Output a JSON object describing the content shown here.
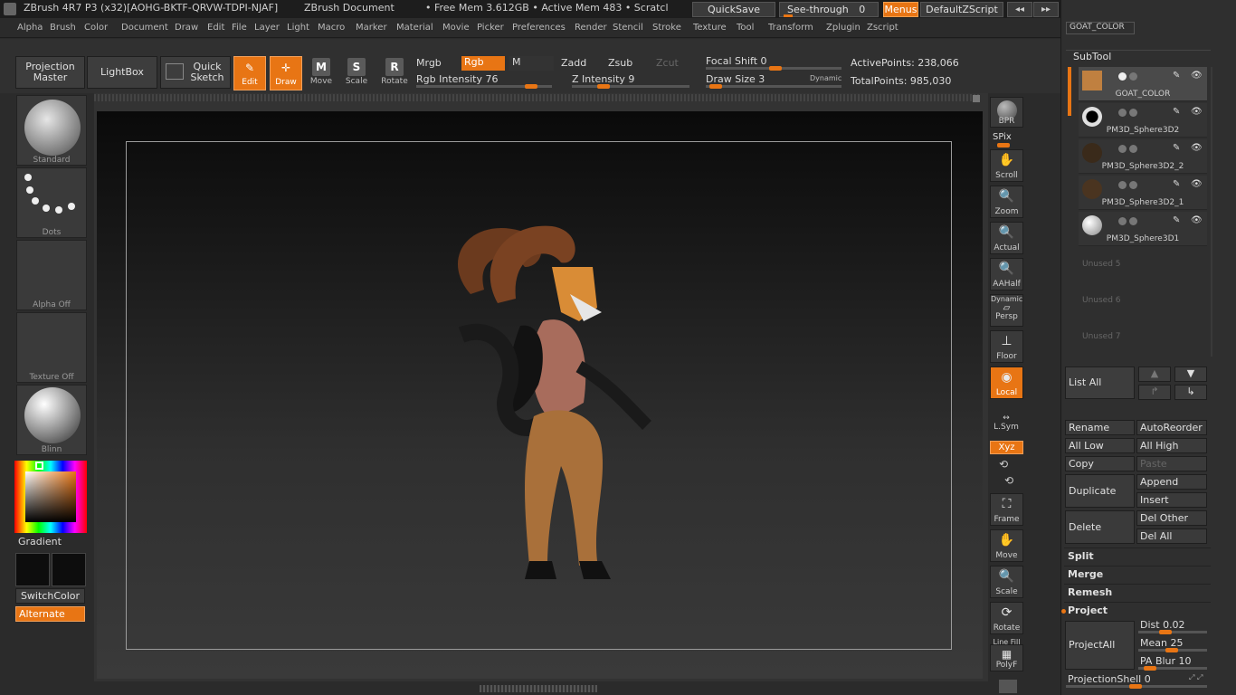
{
  "titlebar": {
    "app": "ZBrush 4R7 P3 (x32)[AOHG-BKTF-QRVW-TDPI-NJAF]",
    "document": "ZBrush Document",
    "mem": "• Free Mem 3.612GB • Active Mem 483 • Scratcl",
    "quicksave": "QuickSave",
    "see_through_label": "See-through",
    "see_through_value": "0",
    "menus": "Menus",
    "script": "DefaultZScript"
  },
  "menu": [
    "Alpha",
    "Brush",
    "Color",
    "Document",
    "Draw",
    "Edit",
    "File",
    "Layer",
    "Light",
    "Macro",
    "Marker",
    "Material",
    "Movie",
    "Picker",
    "Preferences",
    "Render",
    "Stencil",
    "Stroke",
    "Texture",
    "Tool",
    "Transform",
    "Zplugin",
    "Zscript"
  ],
  "toolbar": {
    "projection_master": "Projection Master",
    "lightbox": "LightBox",
    "quick_sketch": "Quick Sketch",
    "edit": "Edit",
    "draw": "Draw",
    "move": "Move",
    "scale": "Scale",
    "rotate": "Rotate",
    "mrgb": "Mrgb",
    "rgb": "Rgb",
    "m": "M",
    "zadd": "Zadd",
    "zsub": "Zsub",
    "zcut": "Zcut",
    "rgb_intensity": "Rgb Intensity 76",
    "z_intensity": "Z Intensity 9",
    "focal_shift": "Focal Shift 0",
    "draw_size": "Draw Size 3",
    "dynamic": "Dynamic",
    "active_points": "ActivePoints: 238,066",
    "total_points": "TotalPoints: 985,030"
  },
  "left": {
    "brush": "Standard",
    "stroke": "Dots",
    "alpha": "Alpha Off",
    "texture": "Texture Off",
    "material": "Blinn",
    "gradient": "Gradient",
    "switchcolor": "SwitchColor",
    "alternate": "Alternate"
  },
  "right_tools": {
    "bpr": "BPR",
    "spix": "SPix",
    "scroll": "Scroll",
    "zoom": "Zoom",
    "actual": "Actual",
    "aahalf": "AAHalf",
    "dynamic": "Dynamic",
    "persp": "Persp",
    "floor": "Floor",
    "local": "Local",
    "lsym": "L.Sym",
    "xyz": "Xyz",
    "frame": "Frame",
    "move": "Move",
    "scale": "Scale",
    "rotate": "Rotate",
    "line_fill": "Line Fill",
    "polyf": "PolyF"
  },
  "subtool": {
    "top_label": "GOAT_COLOR",
    "header": "SubTool",
    "items": [
      "GOAT_COLOR",
      "PM3D_Sphere3D2",
      "PM3D_Sphere3D2_2",
      "PM3D_Sphere3D2_1",
      "PM3D_Sphere3D1"
    ],
    "unused": [
      "Unused 5",
      "Unused 6",
      "Unused 7"
    ],
    "list_all": "List All",
    "rename": "Rename",
    "autoreorder": "AutoReorder",
    "all_low": "All Low",
    "all_high": "All High",
    "copy": "Copy",
    "paste": "Paste",
    "duplicate": "Duplicate",
    "append": "Append",
    "insert": "Insert",
    "delete": "Delete",
    "del_other": "Del Other",
    "del_all": "Del All",
    "split": "Split",
    "merge": "Merge",
    "remesh": "Remesh",
    "project": "Project",
    "projectall": "ProjectAll",
    "dist": "Dist 0.02",
    "mean": "Mean 25",
    "pa_blur": "PA Blur 10",
    "projection_shell": "ProjectionShell 0"
  }
}
